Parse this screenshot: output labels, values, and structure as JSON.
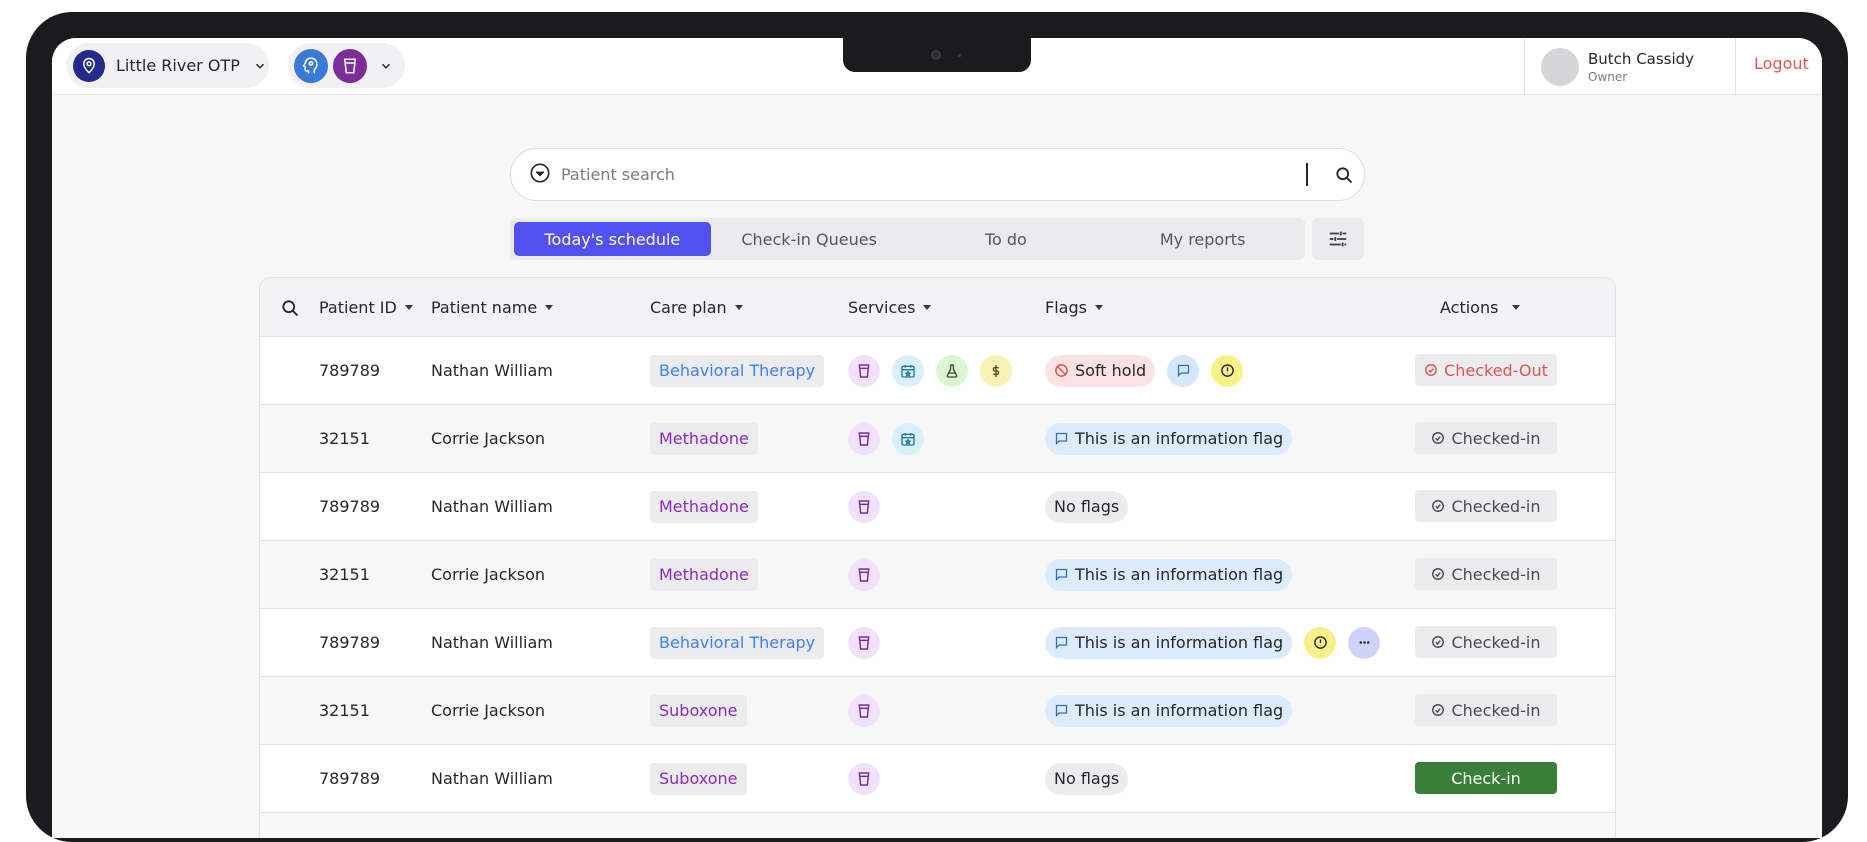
{
  "topbar": {
    "location": "Little River OTP",
    "user_name": "Butch Cassidy",
    "user_role": "Owner",
    "logout_label": "Logout"
  },
  "search": {
    "placeholder": "Patient search",
    "value": ""
  },
  "tabs": [
    {
      "label": "Today's schedule",
      "active": true
    },
    {
      "label": "Check-in Queues",
      "active": false
    },
    {
      "label": "To do",
      "active": false
    },
    {
      "label": "My reports",
      "active": false
    }
  ],
  "table": {
    "columns": {
      "patient_id": "Patient ID",
      "patient_name": "Patient name",
      "care_plan": "Care plan",
      "services": "Services",
      "flags": "Flags",
      "actions": "Actions"
    },
    "rows": [
      {
        "id": "789789",
        "name": "Nathan William",
        "care_plan": "Behavioral Therapy",
        "services": [
          "cup-icon",
          "calendar-star-icon",
          "flask-icon",
          "dollar-icon"
        ],
        "flags": [
          "Soft hold",
          "chat-icon",
          "alert-icon"
        ],
        "status": "Checked-Out"
      },
      {
        "id": "32151",
        "name": "Corrie Jackson",
        "care_plan": "Methadone",
        "services": [
          "cup-icon",
          "calendar-star-icon"
        ],
        "flags": [
          "This is an information flag"
        ],
        "status": "Checked-in"
      },
      {
        "id": "789789",
        "name": "Nathan William",
        "care_plan": "Methadone",
        "services": [
          "cup-icon"
        ],
        "flags": [
          "No flags"
        ],
        "status": "Checked-in"
      },
      {
        "id": "32151",
        "name": "Corrie Jackson",
        "care_plan": "Methadone",
        "services": [
          "cup-icon"
        ],
        "flags": [
          "This is an information flag"
        ],
        "status": "Checked-in"
      },
      {
        "id": "789789",
        "name": "Nathan William",
        "care_plan": "Behavioral Therapy",
        "services": [
          "cup-icon"
        ],
        "flags": [
          "This is an information flag",
          "alert-icon",
          "more-icon"
        ],
        "status": "Checked-in"
      },
      {
        "id": "32151",
        "name": "Corrie Jackson",
        "care_plan": "Suboxone",
        "services": [
          "cup-icon"
        ],
        "flags": [
          "This is an information flag"
        ],
        "status": "Checked-in"
      },
      {
        "id": "789789",
        "name": "Nathan William",
        "care_plan": "Suboxone",
        "services": [
          "cup-icon"
        ],
        "flags": [
          "No flags"
        ],
        "status": "Check-in"
      }
    ]
  },
  "colors": {
    "accent": "#5151ef",
    "checked_out": "#e0564f",
    "check_in_button": "#38803a",
    "behavioral_therapy": "#3b82f6",
    "medication": "#8a2bc0"
  }
}
